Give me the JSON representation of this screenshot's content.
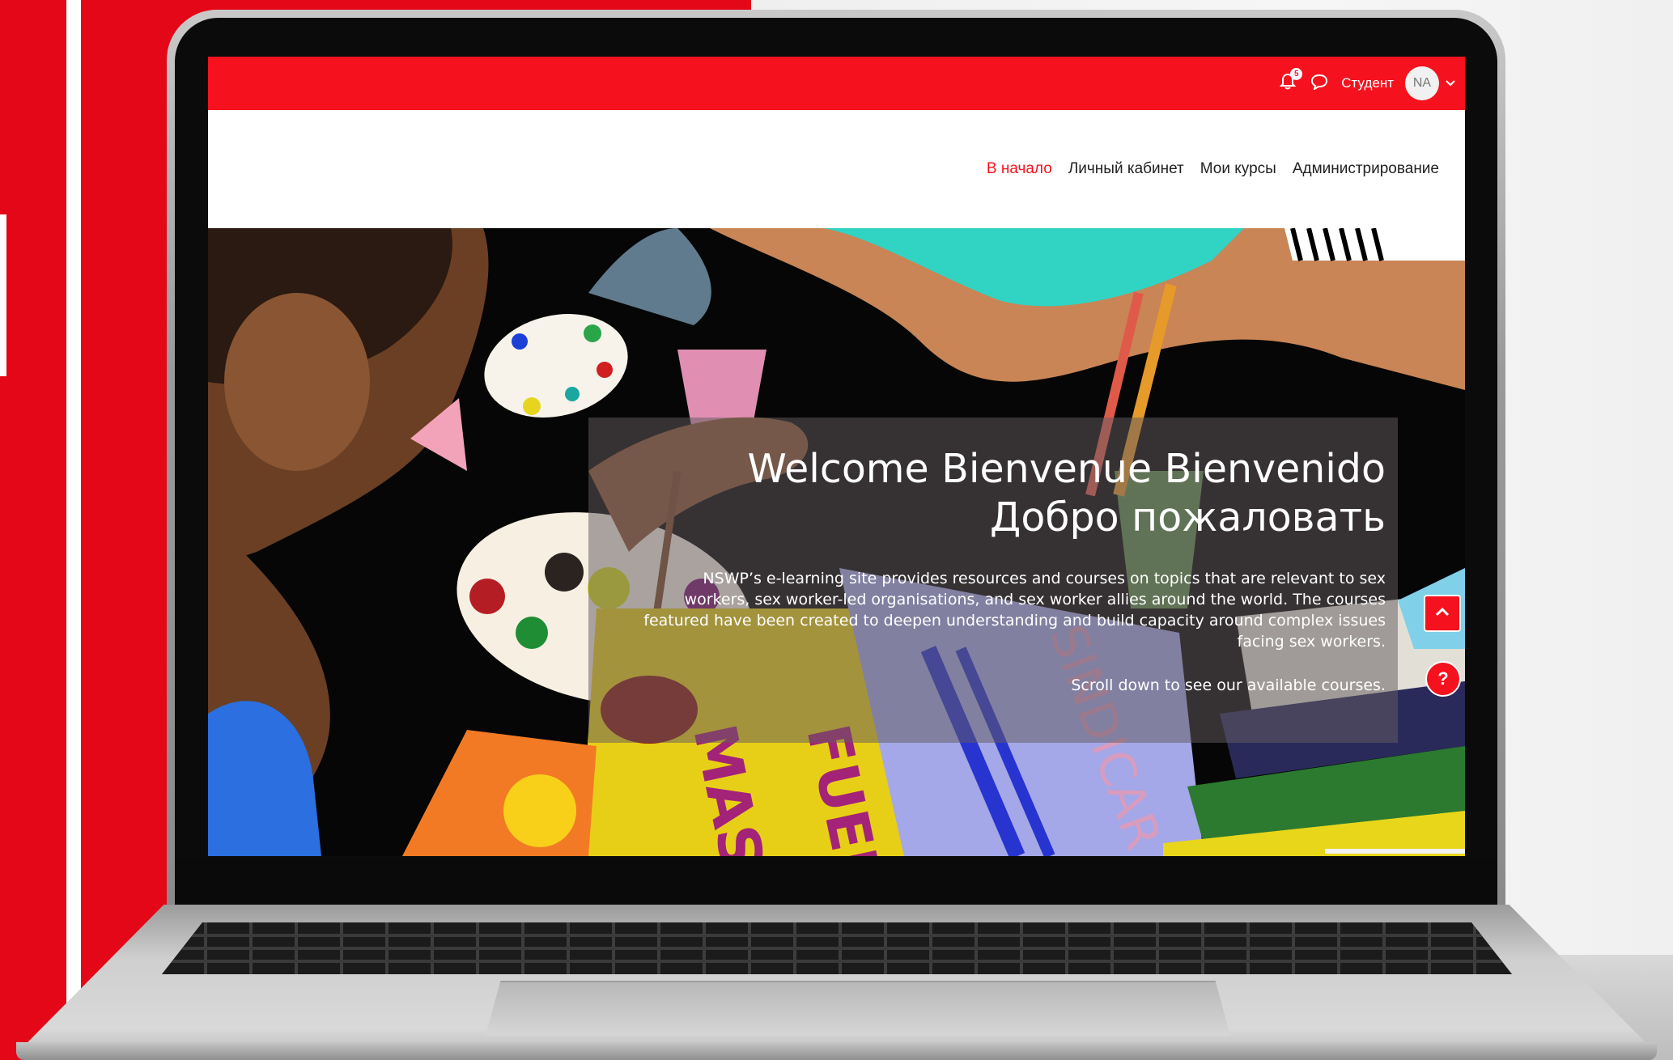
{
  "topbar": {
    "notification_count": "5",
    "user_role": "Студент",
    "avatar_initials": "NA"
  },
  "nav": {
    "items": [
      {
        "label": "В начало",
        "active": true
      },
      {
        "label": "Личный кабинет",
        "active": false
      },
      {
        "label": "Мои курсы",
        "active": false
      },
      {
        "label": "Администрирование",
        "active": false
      }
    ]
  },
  "hero": {
    "title_line1": "Welcome Bienvenue Bienvenido",
    "title_line2": "Добро пожаловать",
    "description": "NSWP’s e-learning site provides resources and courses on topics that are relevant to sex workers, sex worker-led organisations, and sex worker allies around the world. The courses featured have been created to deepen understanding and build capacity around complex issues facing sex workers.",
    "scroll_hint": "Scroll down to see our available courses.",
    "help_label": "?"
  },
  "icons": [
    "bell-icon",
    "chat-icon",
    "chevron-down-icon",
    "chevron-up-icon",
    "help-icon"
  ],
  "colors": {
    "brand_red": "#f5121e",
    "background_red": "#e30718"
  }
}
